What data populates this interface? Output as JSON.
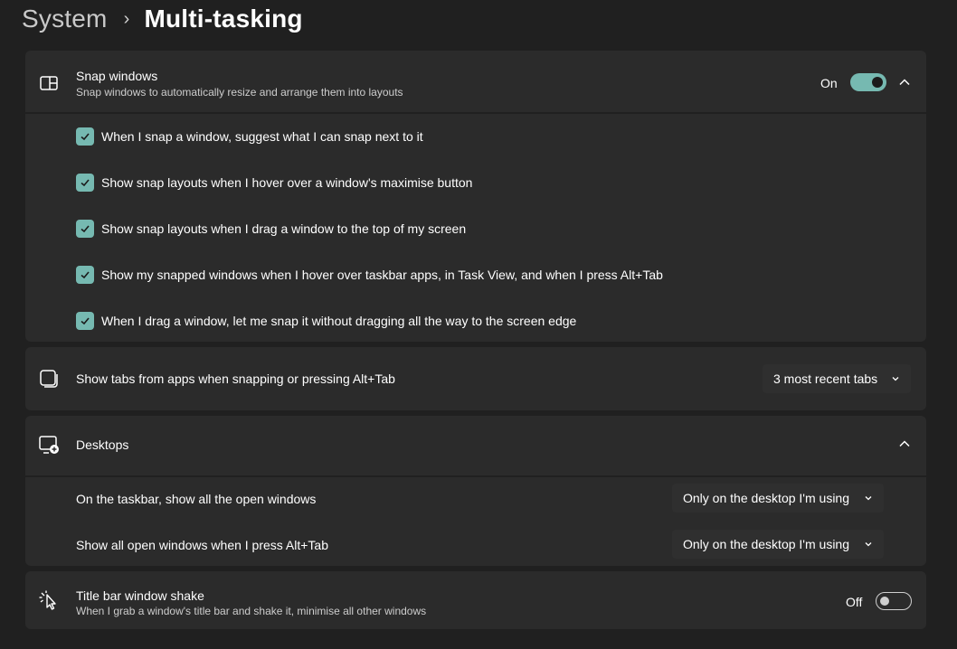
{
  "breadcrumb": {
    "parent": "System",
    "separator": "›",
    "current": "Multi-tasking"
  },
  "snap": {
    "title": "Snap windows",
    "subtitle": "Snap windows to automatically resize and arrange them into layouts",
    "state_label": "On",
    "enabled": true,
    "options": [
      {
        "label": "When I snap a window, suggest what I can snap next to it",
        "checked": true
      },
      {
        "label": "Show snap layouts when I hover over a window's maximise button",
        "checked": true
      },
      {
        "label": "Show snap layouts when I drag a window to the top of my screen",
        "checked": true
      },
      {
        "label": "Show my snapped windows when I hover over taskbar apps, in Task View, and when I press Alt+Tab",
        "checked": true
      },
      {
        "label": "When I drag a window, let me snap it without dragging all the way to the screen edge",
        "checked": true
      }
    ]
  },
  "tabs": {
    "title": "Show tabs from apps when snapping or pressing Alt+Tab",
    "dropdown_value": "3 most recent tabs"
  },
  "desktops": {
    "title": "Desktops",
    "settings": [
      {
        "label": "On the taskbar, show all the open windows",
        "value": "Only on the desktop I'm using"
      },
      {
        "label": "Show all open windows when I press Alt+Tab",
        "value": "Only on the desktop I'm using"
      }
    ]
  },
  "shake": {
    "title": "Title bar window shake",
    "subtitle": "When I grab a window's title bar and shake it, minimise all other windows",
    "state_label": "Off",
    "enabled": false
  },
  "colors": {
    "background": "#202020",
    "card": "#2b2b2b",
    "accent": "#76b9b1",
    "dropdown": "#2f2f2f"
  },
  "icons": {
    "snap": "snap-windows-icon",
    "tabs": "app-tabs-icon",
    "desktops": "virtual-desktops-icon",
    "shake": "window-shake-cursor-icon",
    "expand": "chevron-up-icon",
    "dropdown": "chevron-down-icon",
    "checkmark": "checkmark-icon"
  }
}
